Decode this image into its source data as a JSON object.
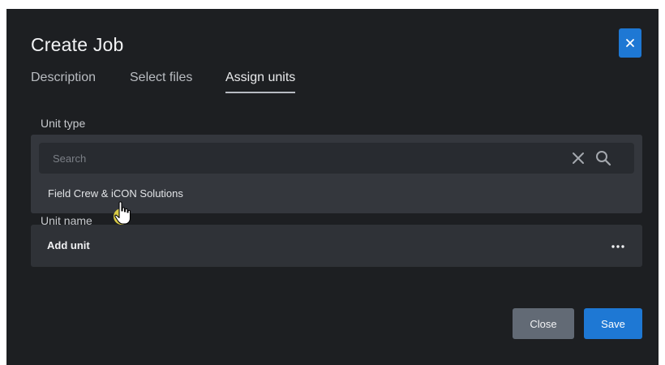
{
  "dialog": {
    "title": "Create Job",
    "close_icon": "close-icon",
    "accent_color": "#1e78d4"
  },
  "tabs": [
    {
      "label": "Description",
      "active": false
    },
    {
      "label": "Select files",
      "active": false
    },
    {
      "label": "Assign units",
      "active": true
    }
  ],
  "unit_type": {
    "label": "Unit type",
    "search": {
      "placeholder": "Search",
      "value": ""
    },
    "options": [
      "Field Crew & iCON Solutions"
    ]
  },
  "unit_name": {
    "label": "Unit name"
  },
  "units": {
    "add_label": "Add unit",
    "more_icon": "more-icon"
  },
  "footer": {
    "close_label": "Close",
    "save_label": "Save"
  }
}
